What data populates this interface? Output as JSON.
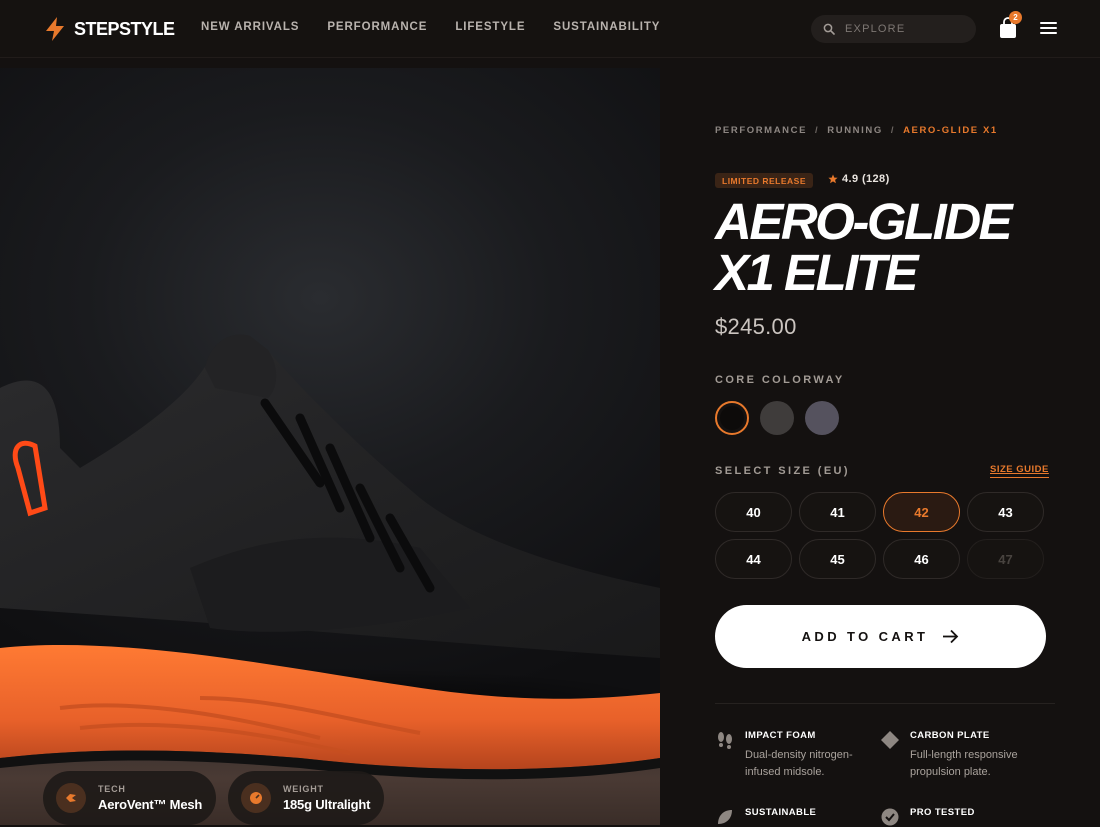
{
  "brand": {
    "name": "STEPSTYLE"
  },
  "nav": {
    "items": [
      "NEW ARRIVALS",
      "PERFORMANCE",
      "LIFESTYLE",
      "SUSTAINABILITY"
    ]
  },
  "search": {
    "placeholder": "EXPLORE"
  },
  "cart": {
    "count": "2"
  },
  "hero": {
    "specs": [
      {
        "label": "TECH",
        "value": "AeroVent™ Mesh",
        "icon": "fan-icon"
      },
      {
        "label": "WEIGHT",
        "value": "185g Ultralight",
        "icon": "gauge-icon"
      }
    ]
  },
  "product": {
    "breadcrumb": [
      "PERFORMANCE",
      "RUNNING",
      "AERO-GLIDE X1"
    ],
    "badge": "LIMITED RELEASE",
    "rating": "4.9 (128)",
    "title_line1": "AERO-GLIDE",
    "title_line2": "X1 ELITE",
    "price": "$245.00",
    "colorway_label": "CORE COLORWAY",
    "colorways": [
      {
        "color": "#0d0b0a",
        "selected": true
      },
      {
        "color": "#3f3c3b",
        "selected": false
      },
      {
        "color": "#55525e",
        "selected": false
      }
    ],
    "size_label": "SELECT SIZE (EU)",
    "size_guide": "SIZE GUIDE",
    "sizes": [
      "40",
      "41",
      "42",
      "43",
      "44",
      "45",
      "46",
      "47"
    ],
    "selected_size": "42",
    "unavailable_sizes": [
      "47"
    ],
    "cta": "ADD TO CART",
    "features": [
      {
        "title": "IMPACT FOAM",
        "desc": "Dual-density nitrogen-infused midsole.",
        "icon": "footprints-icon"
      },
      {
        "title": "CARBON PLATE",
        "desc": "Full-length responsive propulsion plate.",
        "icon": "diamond-icon"
      },
      {
        "title": "SUSTAINABLE",
        "desc": "",
        "icon": "leaf-icon"
      },
      {
        "title": "PRO TESTED",
        "desc": "",
        "icon": "verified-badge-icon"
      }
    ]
  },
  "colors": {
    "accent": "#e8792c",
    "background": "#141110"
  }
}
